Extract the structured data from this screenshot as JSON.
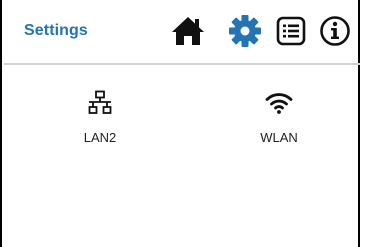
{
  "header": {
    "title": "Settings",
    "title_color": "#2374b5",
    "nav_icons": [
      "home-icon",
      "gear-icon",
      "list-icon",
      "info-icon"
    ],
    "active_icon": "gear-icon",
    "active_color": "#2374b5"
  },
  "tiles": [
    {
      "label": "LAN2",
      "icon": "network-icon"
    },
    {
      "label": "WLAN",
      "icon": "wifi-icon"
    }
  ]
}
